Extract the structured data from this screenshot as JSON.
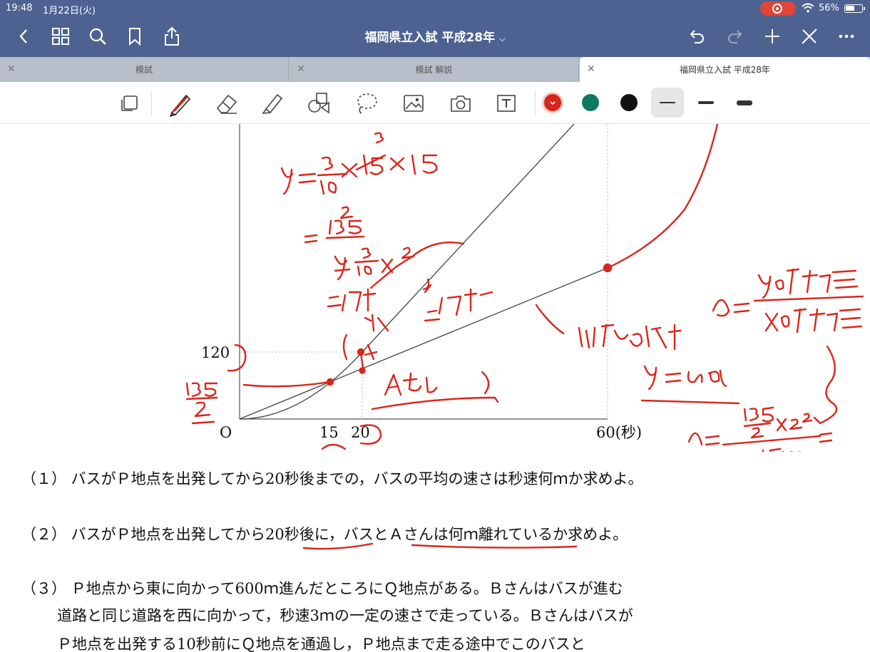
{
  "status": {
    "time": "19:48",
    "date": "1月22日(火)",
    "battery": "56%",
    "battery_level": 0.56
  },
  "nav": {
    "title": "福岡県立入試 平成28年"
  },
  "tabs": [
    {
      "label": "模試"
    },
    {
      "label": "模試 解説"
    },
    {
      "label": "福岡県立入試 平成28年",
      "active": true
    }
  ],
  "toolbar": {
    "tools": [
      "page-icon",
      "pen-icon",
      "eraser-icon",
      "highlighter-icon",
      "shapes-icon",
      "lasso-icon",
      "image-icon",
      "camera-icon",
      "text-box-icon"
    ],
    "colors": [
      "#d9261c",
      "#0e7a5f",
      "#111111"
    ],
    "selected_color": "#d9261c"
  },
  "graph": {
    "y_tick": "120",
    "origin": "O",
    "x_ticks": [
      "15",
      "20",
      "60(秒)"
    ]
  },
  "questions": {
    "q1": "（１）  バスがＰ地点を出発してから20秒後までの，バスの平均の速さは秒速何ｍか求めよ。",
    "q2": "（２）  バスがＰ地点を出発してから20秒後に，バスとＡさんは何ｍ離れているか求めよ。",
    "q3_line1": "（３）  Ｐ地点から東に向かって600ｍ進んだところにＱ地点がある。Ｂさんはバスが進む",
    "q3_line2": "道路と同じ道路を西に向かって，秒速3ｍの一定の速さで走っている。Ｂさんはバスが",
    "q3_line3": "Ｐ地点を出発する10秒前にＱ地点を通過し，Ｐ地点まで走る途中でこのバスと"
  },
  "handwriting": {
    "color": "#d9261c",
    "notes": [
      "y=3/10×15×15",
      "=135/2",
      "y=3/10x²",
      "二次関数",
      "一次関数",
      "比例の式",
      "a=yの増加量/xの増加量",
      "y=ax",
      "Aさん",
      "135/2"
    ]
  }
}
